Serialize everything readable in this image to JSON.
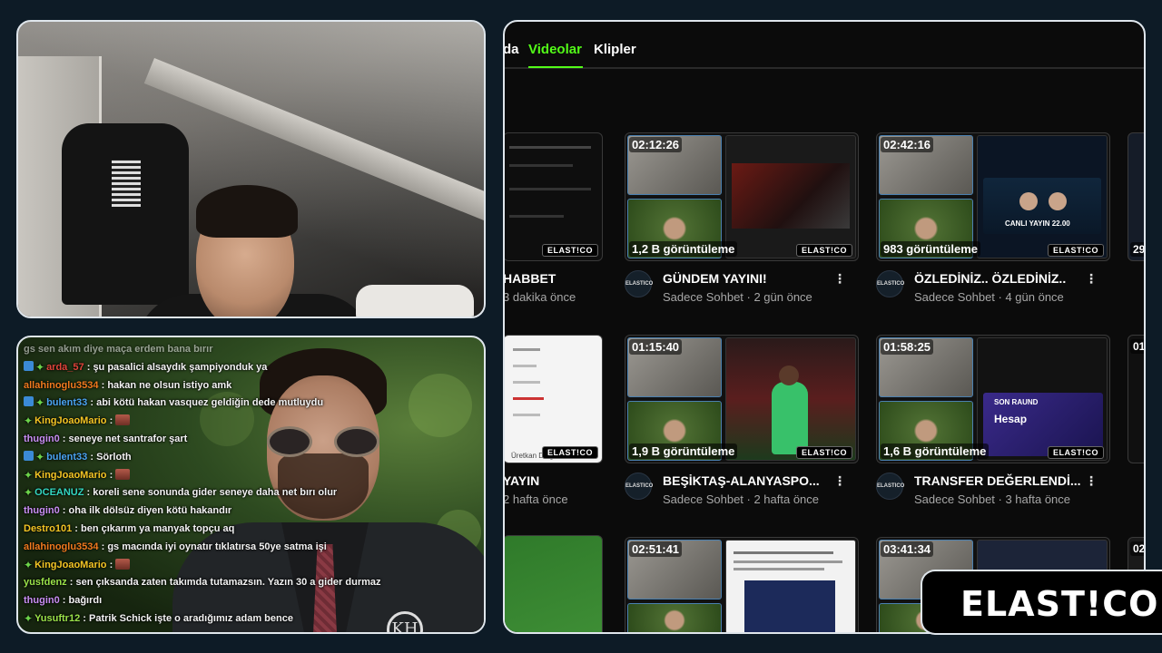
{
  "browser": {
    "tabs": [
      {
        "label": "da",
        "active": false
      },
      {
        "label": "Videolar",
        "active": true
      },
      {
        "label": "Klipler",
        "active": false
      }
    ],
    "accent_color": "#53fc18",
    "channel_avatar_text": "ELASTICO",
    "watermark": "ELAST!CO",
    "row1_partial_left": {
      "title": "HABBET",
      "meta": "3 dakika önce"
    },
    "row1_partial_right": {
      "duration": "29"
    },
    "row2_partial_left": {
      "title": "YAYIN",
      "meta": "2 hafta önce",
      "caption": "Üretkan Dolgo'da"
    },
    "row2_partial_right": {
      "duration": "01"
    },
    "row3_partial_right": {
      "duration": "02"
    },
    "videos": [
      {
        "duration": "02:12:26",
        "views": "1,2 B görüntüleme",
        "title": "GÜNDEM YAYINI!",
        "meta": "Sadece Sohbet · 2 gün önce"
      },
      {
        "duration": "02:42:16",
        "views": "983 görüntüleme",
        "title": "ÖZLEDİNİZ.. ÖZLEDİNİZ..",
        "meta": "Sadece Sohbet · 4 gün önce"
      },
      {
        "duration": "01:15:40",
        "views": "1,9 B görüntüleme",
        "title": "BEŞİKTAŞ-ALANYASPO...",
        "meta": "Sadece Sohbet · 2 hafta önce"
      },
      {
        "duration": "01:58:25",
        "views": "1,6 B görüntüleme",
        "title": "TRANSFER DEĞERLENDİ...",
        "meta": "Sadece Sohbet · 3 hafta önce"
      },
      {
        "duration": "02:51:41"
      },
      {
        "duration": "03:41:34"
      }
    ],
    "thumb_texts": {
      "banner1": "CANLI YAYIN 22.00",
      "banner2": "SON RAUND",
      "banner3": "Hesap"
    }
  },
  "chat": {
    "messages": [
      {
        "badges": [],
        "user": "",
        "user_color": "#ffffff",
        "text": "gs sen akım diye maça erdem bana bırır"
      },
      {
        "badges": [
          "blue",
          "green"
        ],
        "user": "arda_57",
        "user_color": "#e0443a",
        "text": "şu pasalici alsaydık şampiyonduk ya"
      },
      {
        "badges": [],
        "user": "allahinoglu3534",
        "user_color": "#f07a1e",
        "text": "hakan ne olsun istiyo amk"
      },
      {
        "badges": [
          "blue",
          "green"
        ],
        "user": "bulent33",
        "user_color": "#4aa3f0",
        "text": "abi kötü hakan vasquez geldiğin dede mutluydu"
      },
      {
        "badges": [
          "green"
        ],
        "user": "KingJoaoMario",
        "user_color": "#f4c524",
        "text": "",
        "emote": true
      },
      {
        "badges": [],
        "user": "thugin0",
        "user_color": "#c98ff3",
        "text": "seneye net santrafor şart"
      },
      {
        "badges": [
          "blue",
          "green"
        ],
        "user": "bulent33",
        "user_color": "#4aa3f0",
        "text": "Sörloth"
      },
      {
        "badges": [
          "green"
        ],
        "user": "KingJoaoMario",
        "user_color": "#f4c524",
        "text": "",
        "emote": true
      },
      {
        "badges": [
          "green"
        ],
        "user": "OCEANUZ",
        "user_color": "#33d6c0",
        "text": "koreli sene sonunda gider seneye daha net bırı olur"
      },
      {
        "badges": [],
        "user": "thugin0",
        "user_color": "#c98ff3",
        "text": "oha ilk dölsüz diyen kötü hakandır"
      },
      {
        "badges": [],
        "user": "Destro101",
        "user_color": "#f4c524",
        "text": "ben çıkarım ya manyak topçu aq"
      },
      {
        "badges": [],
        "user": "allahinoglu3534",
        "user_color": "#f07a1e",
        "text": "gs macında iyi oynatır tıklatırsa 50ye satma işi"
      },
      {
        "badges": [
          "green"
        ],
        "user": "KingJoaoMario",
        "user_color": "#f4c524",
        "text": "",
        "emote": true
      },
      {
        "badges": [],
        "user": "yusfdenz",
        "user_color": "#9be34a",
        "text": "sen çıksanda zaten takımda tutamazsın. Yazın 30 a gider durmaz"
      },
      {
        "badges": [],
        "user": "thugin0",
        "user_color": "#c98ff3",
        "text": "bağırdı"
      },
      {
        "badges": [
          "green"
        ],
        "user": "Yusuftr12",
        "user_color": "#9be34a",
        "text": "Patrik Schick işte o aradığımız adam bence"
      }
    ],
    "overlay_monogram": "KH"
  },
  "brand": {
    "logo_text": "ELAST!CO"
  }
}
